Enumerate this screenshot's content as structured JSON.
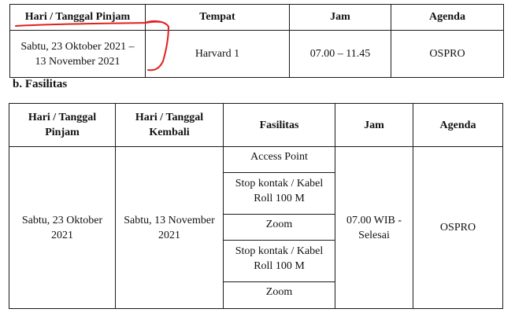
{
  "table1": {
    "headers": [
      "Hari / Tanggal Pinjam",
      "Tempat",
      "Jam",
      "Agenda"
    ],
    "row": {
      "date_line1": "Sabtu, 23 Oktober 2021 –",
      "date_line2": "13 November 2021",
      "place": "Harvard 1",
      "time": "07.00 – 11.45",
      "agenda": "OSPRO"
    }
  },
  "section_b": {
    "title": "b. Fasilitas"
  },
  "table2": {
    "headers": {
      "borrow_date_line1": "Hari / Tanggal",
      "borrow_date_line2": "Pinjam",
      "return_date_line1": "Hari / Tanggal",
      "return_date_line2": "Kembali",
      "facilities": "Fasilitas",
      "time": "Jam",
      "agenda": "Agenda"
    },
    "borrow_date_line1": "Sabtu, 23 Oktober",
    "borrow_date_line2": "2021",
    "return_date_line1": "Sabtu, 13 November",
    "return_date_line2": "2021",
    "facilities": [
      {
        "line1": "Access Point",
        "line2": ""
      },
      {
        "line1": "Stop kontak / Kabel",
        "line2": "Roll 100 M"
      },
      {
        "line1": "Zoom",
        "line2": ""
      },
      {
        "line1": "Stop kontak / Kabel",
        "line2": "Roll 100 M"
      },
      {
        "line1": "Zoom",
        "line2": ""
      }
    ],
    "time_line1": "07.00 WIB -",
    "time_line2": "Selesai",
    "agenda": "OSPRO"
  },
  "colors": {
    "annotation": "#e0201e",
    "border": "#1a1a1a"
  }
}
